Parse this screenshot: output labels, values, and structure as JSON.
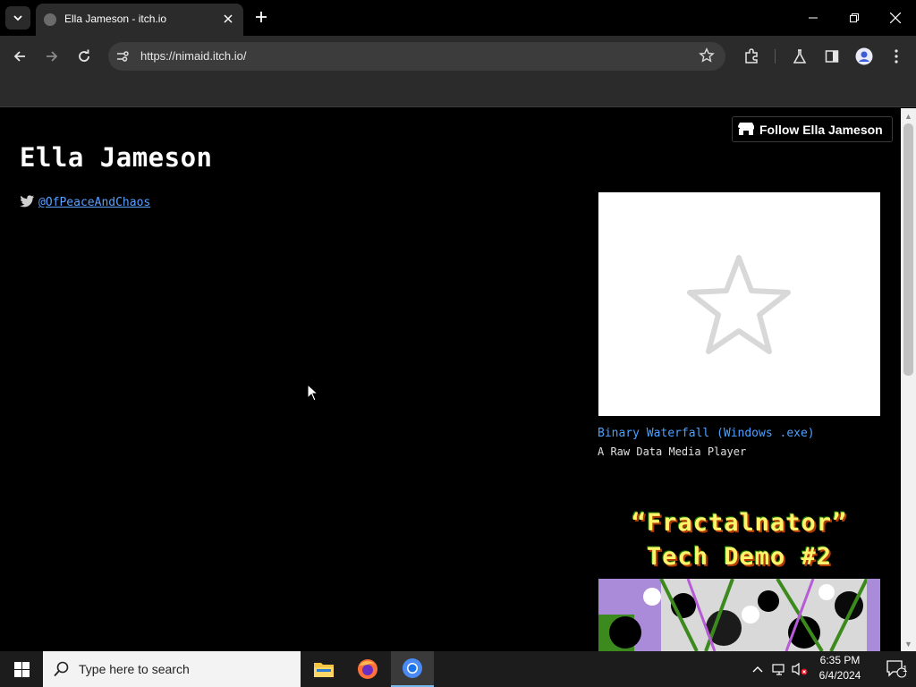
{
  "browser": {
    "tab_title": "Ella Jameson - itch.io",
    "url": "https://nimaid.itch.io/"
  },
  "page": {
    "follow_label": "Follow Ella Jameson",
    "title": "Ella Jameson",
    "twitter_handle": "@OfPeaceAndChaos",
    "games": [
      {
        "title": "Binary Waterfall (Windows .exe)",
        "description": "A Raw Data Media Player"
      },
      {
        "thumb_line1": "“Fractalnator”",
        "thumb_line2": "Tech Demo #2"
      }
    ]
  },
  "taskbar": {
    "search_placeholder": "Type here to search",
    "time": "6:35 PM",
    "date": "6/4/2024",
    "notification_count": "1"
  },
  "colors": {
    "link": "#4aa0ff",
    "page_bg": "#000000",
    "chrome_bg": "#2b2b2b"
  }
}
